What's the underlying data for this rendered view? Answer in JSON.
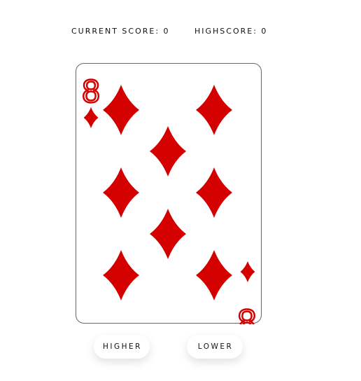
{
  "scoreboard": {
    "current_score": "CURRENT SCORE: 0",
    "highscore": "HIGHSCORE: 0"
  },
  "card": {
    "rank": "8",
    "suit": "diamonds",
    "suit_color": "#d40000"
  },
  "controls": {
    "higher_label": "HIGHER",
    "lower_label": "LOWER"
  }
}
